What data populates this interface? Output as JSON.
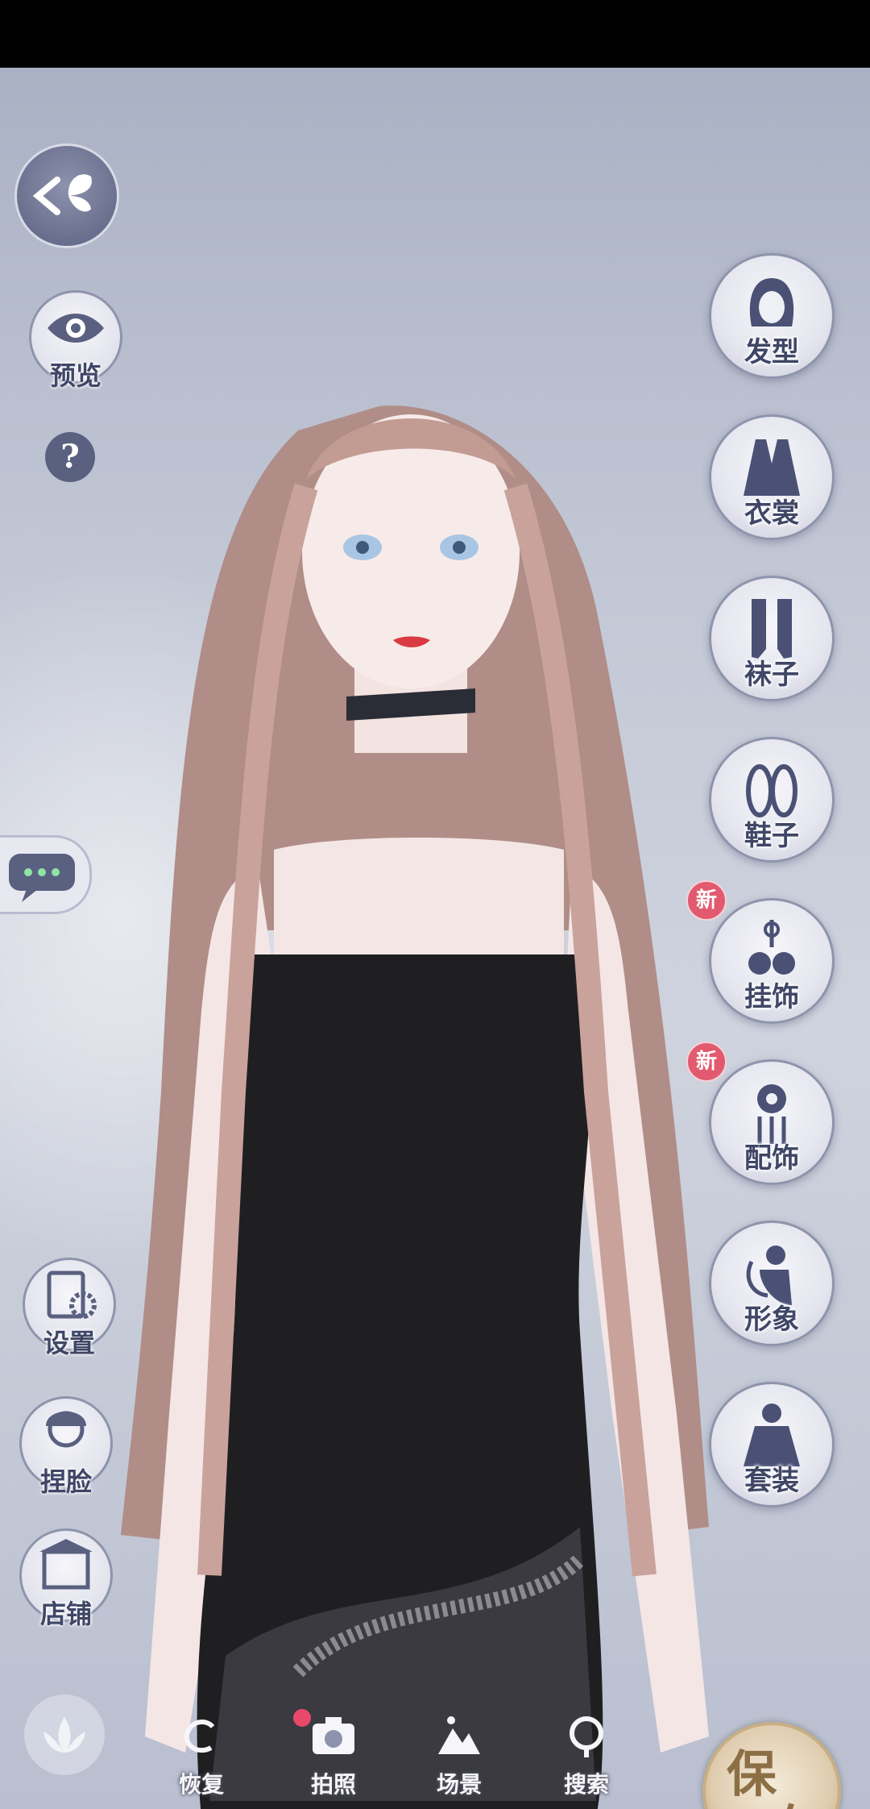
{
  "left_menu": {
    "back_icon": "butterfly-back-icon",
    "preview_label": "预览",
    "help_label": "?",
    "settings_label": "设置",
    "face_label": "捏脸",
    "shop_label": "店铺"
  },
  "right_menu": {
    "items": [
      {
        "label": "发型",
        "icon": "hairstyle-icon",
        "new": false
      },
      {
        "label": "衣裳",
        "icon": "clothing-icon",
        "new": false
      },
      {
        "label": "袜子",
        "icon": "socks-icon",
        "new": false
      },
      {
        "label": "鞋子",
        "icon": "shoes-icon",
        "new": false
      },
      {
        "label": "挂饰",
        "icon": "pendant-icon",
        "new": true
      },
      {
        "label": "配饰",
        "icon": "accessory-icon",
        "new": true
      },
      {
        "label": "形象",
        "icon": "image-icon",
        "new": false
      },
      {
        "label": "套装",
        "icon": "outfit-icon",
        "new": false
      }
    ],
    "new_badge": "新"
  },
  "bottom_bar": {
    "restore_label": "恢复",
    "photo_label": "拍照",
    "scene_label": "场景",
    "search_label": "搜索"
  },
  "save": {
    "label_1": "保",
    "label_2": "存"
  },
  "colors": {
    "accent": "#3f4666",
    "badge": "#e25a6f",
    "save_gold": "#c8ae84"
  }
}
